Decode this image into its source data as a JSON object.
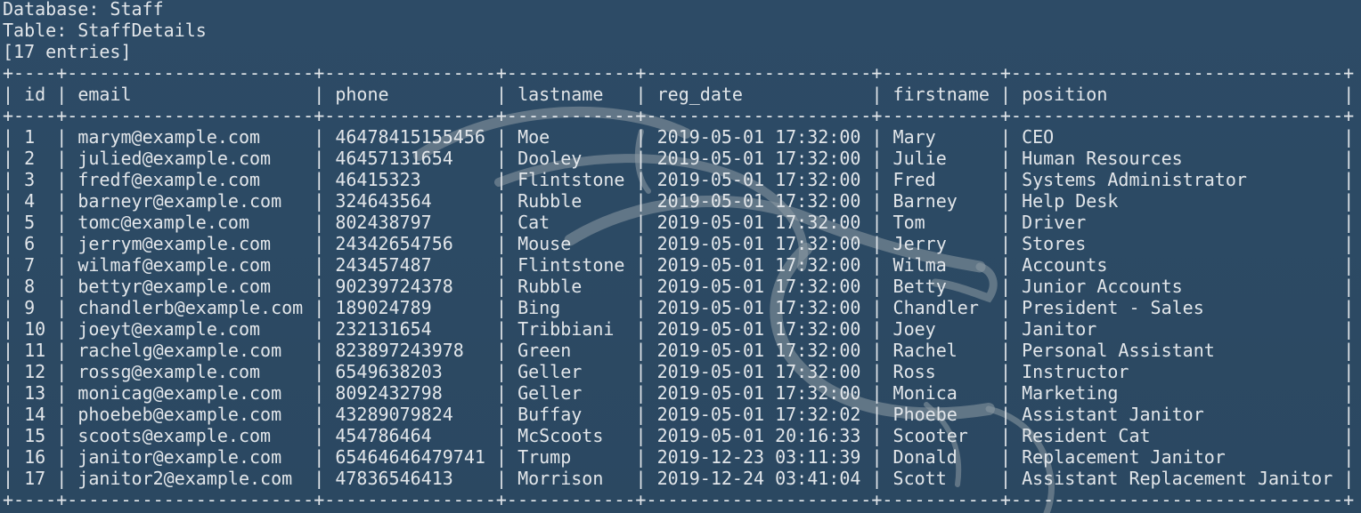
{
  "terminal": {
    "database_line": "Database: Staff",
    "table_line": "Table: StaffDetails",
    "entries_line": "[17 entries]"
  },
  "table": {
    "columns": [
      "id",
      "email",
      "phone",
      "lastname",
      "reg_date",
      "firstname",
      "position"
    ],
    "rows": [
      [
        "1",
        "marym@example.com",
        "46478415155456",
        "Moe",
        "2019-05-01 17:32:00",
        "Mary",
        "CEO"
      ],
      [
        "2",
        "julied@example.com",
        "46457131654",
        "Dooley",
        "2019-05-01 17:32:00",
        "Julie",
        "Human Resources"
      ],
      [
        "3",
        "fredf@example.com",
        "46415323",
        "Flintstone",
        "2019-05-01 17:32:00",
        "Fred",
        "Systems Administrator"
      ],
      [
        "4",
        "barneyr@example.com",
        "324643564",
        "Rubble",
        "2019-05-01 17:32:00",
        "Barney",
        "Help Desk"
      ],
      [
        "5",
        "tomc@example.com",
        "802438797",
        "Cat",
        "2019-05-01 17:32:00",
        "Tom",
        "Driver"
      ],
      [
        "6",
        "jerrym@example.com",
        "24342654756",
        "Mouse",
        "2019-05-01 17:32:00",
        "Jerry",
        "Stores"
      ],
      [
        "7",
        "wilmaf@example.com",
        "243457487",
        "Flintstone",
        "2019-05-01 17:32:00",
        "Wilma",
        "Accounts"
      ],
      [
        "8",
        "bettyr@example.com",
        "90239724378",
        "Rubble",
        "2019-05-01 17:32:00",
        "Betty",
        "Junior Accounts"
      ],
      [
        "9",
        "chandlerb@example.com",
        "189024789",
        "Bing",
        "2019-05-01 17:32:00",
        "Chandler",
        "President - Sales"
      ],
      [
        "10",
        "joeyt@example.com",
        "232131654",
        "Tribbiani",
        "2019-05-01 17:32:00",
        "Joey",
        "Janitor"
      ],
      [
        "11",
        "rachelg@example.com",
        "823897243978",
        "Green",
        "2019-05-01 17:32:00",
        "Rachel",
        "Personal Assistant"
      ],
      [
        "12",
        "rossg@example.com",
        "6549638203",
        "Geller",
        "2019-05-01 17:32:00",
        "Ross",
        "Instructor"
      ],
      [
        "13",
        "monicag@example.com",
        "8092432798",
        "Geller",
        "2019-05-01 17:32:00",
        "Monica",
        "Marketing"
      ],
      [
        "14",
        "phoebeb@example.com",
        "43289079824",
        "Buffay",
        "2019-05-01 17:32:02",
        "Phoebe",
        "Assistant Janitor"
      ],
      [
        "15",
        "scoots@example.com",
        "454786464",
        "McScoots",
        "2019-05-01 20:16:33",
        "Scooter",
        "Resident Cat"
      ],
      [
        "16",
        "janitor@example.com",
        "65464646479741",
        "Trump",
        "2019-12-23 03:11:39",
        "Donald",
        "Replacement Janitor"
      ],
      [
        "17",
        "janitor2@example.com",
        "47836546413",
        "Morrison",
        "2019-12-24 03:41:04",
        "Scott",
        "Assistant Replacement Janitor"
      ]
    ]
  },
  "colors": {
    "background": "#2c4a64",
    "text": "#e2e6ea",
    "watermark": "#8a98a2"
  },
  "icons": {
    "watermark": "kali-dragon-icon"
  }
}
